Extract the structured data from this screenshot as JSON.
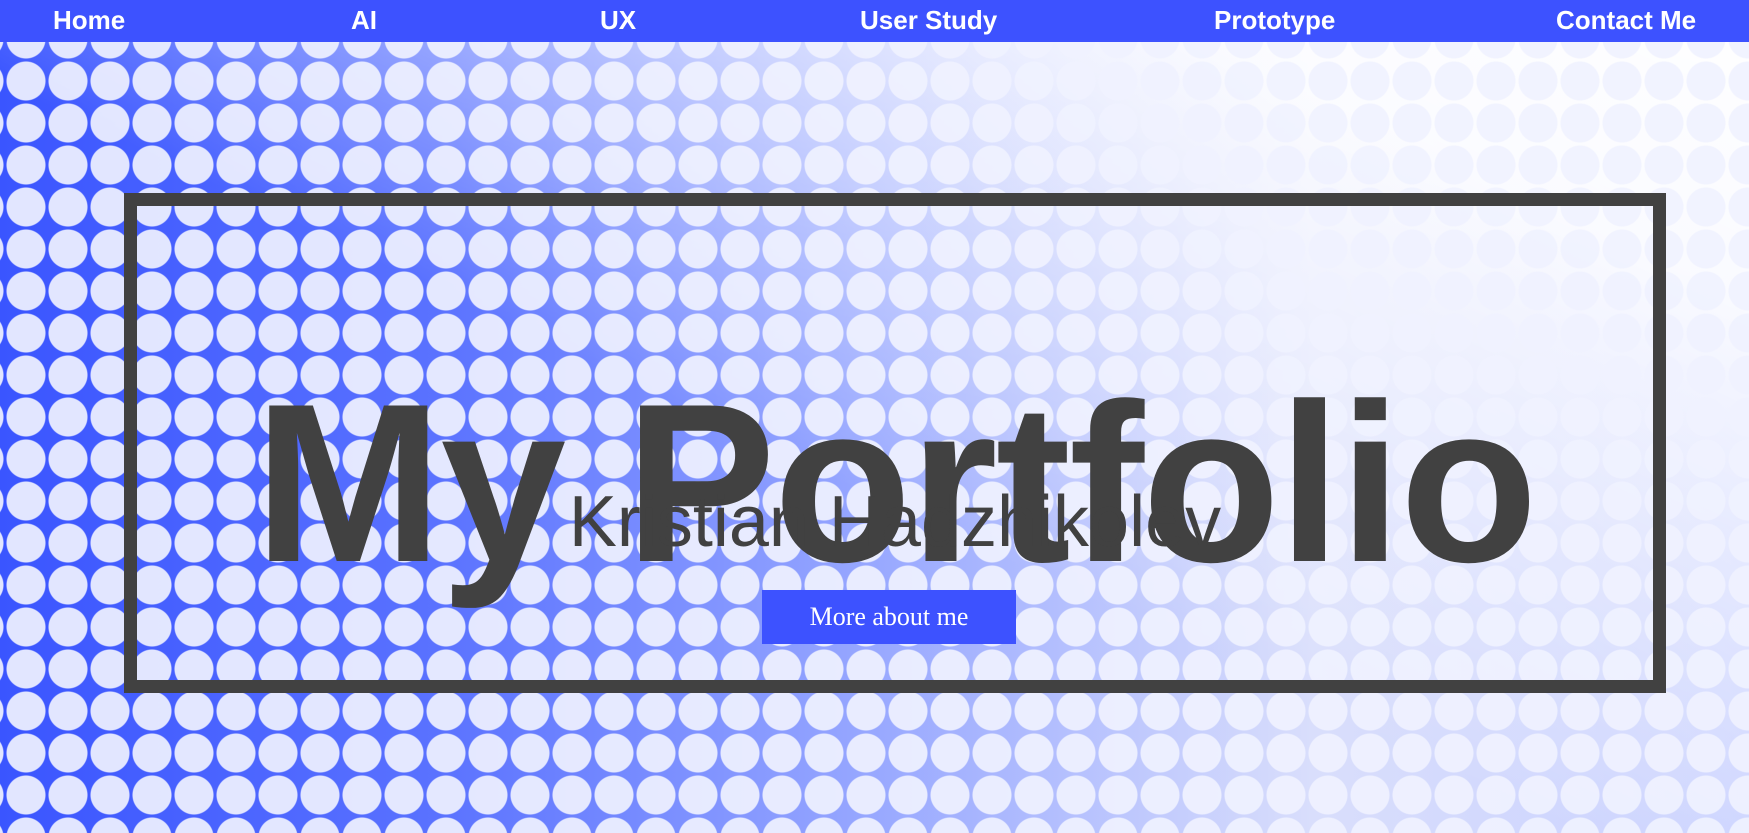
{
  "nav": {
    "items": [
      {
        "label": "Home"
      },
      {
        "label": "AI"
      },
      {
        "label": "UX"
      },
      {
        "label": "User Study"
      },
      {
        "label": "Prototype"
      },
      {
        "label": "Contact Me"
      }
    ]
  },
  "hero": {
    "title": "My Portfolio",
    "subtitle": "Kristian Hadzhikolev",
    "cta_label": "More about me"
  },
  "colors": {
    "accent": "#3d52ff",
    "frame": "#414141",
    "text_dark": "#414141"
  }
}
